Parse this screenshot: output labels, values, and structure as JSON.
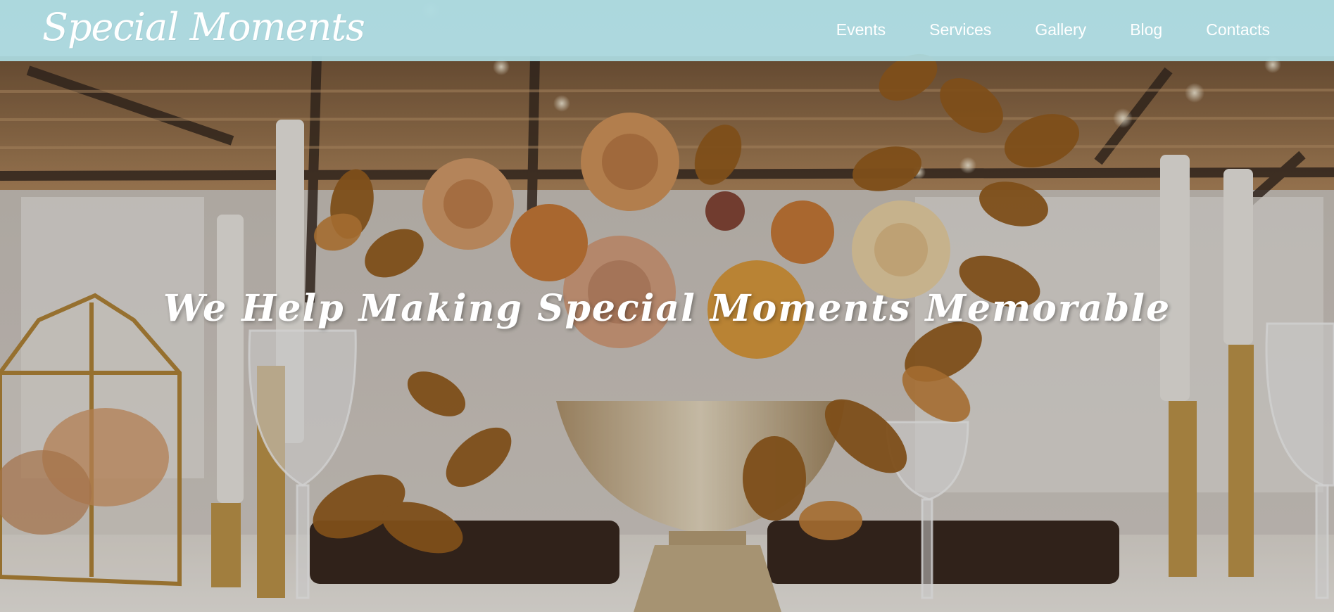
{
  "brand": {
    "logo_text": "Special Moments"
  },
  "nav": {
    "items": [
      {
        "label": "Events"
      },
      {
        "label": "Services"
      },
      {
        "label": "Gallery"
      },
      {
        "label": "Blog"
      },
      {
        "label": "Contacts"
      }
    ]
  },
  "hero": {
    "tagline": "We Help Making Special Moments Memorable",
    "image_subject": "wedding-table-floral-centerpiece"
  },
  "colors": {
    "navbar_bg": "#acdce2",
    "nav_text": "#ffffff",
    "tagline_text": "#ffffff"
  }
}
